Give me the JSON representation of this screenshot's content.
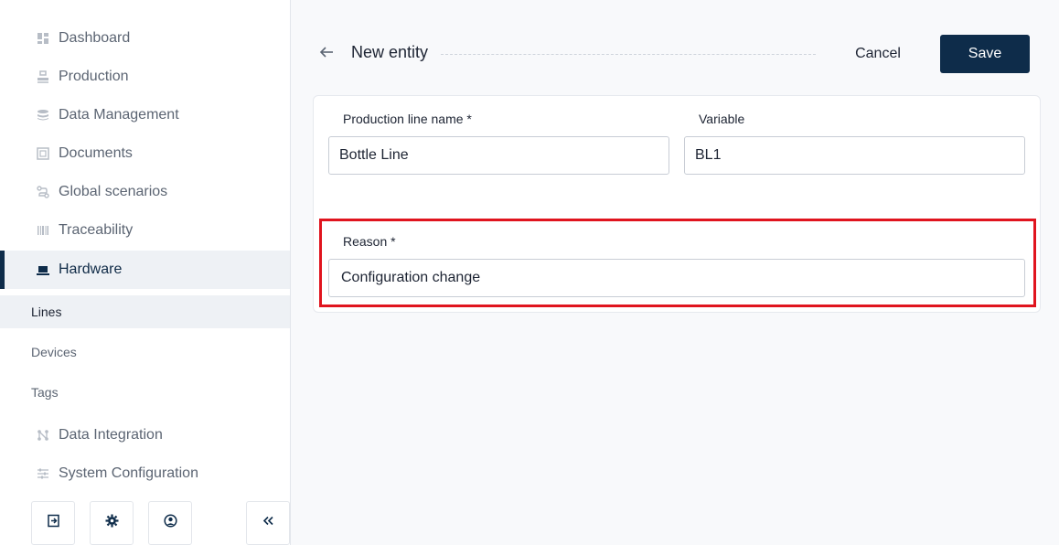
{
  "sidebar": {
    "items": [
      {
        "label": "Dashboard",
        "icon": "dashboard-icon"
      },
      {
        "label": "Production",
        "icon": "production-icon"
      },
      {
        "label": "Data Management",
        "icon": "database-icon"
      },
      {
        "label": "Documents",
        "icon": "documents-icon"
      },
      {
        "label": "Global scenarios",
        "icon": "scenarios-icon"
      },
      {
        "label": "Traceability",
        "icon": "barcode-icon"
      },
      {
        "label": "Hardware",
        "icon": "hardware-icon",
        "active": true
      }
    ],
    "sub_items": [
      {
        "label": "Lines",
        "active": true
      },
      {
        "label": "Devices"
      },
      {
        "label": "Tags"
      }
    ],
    "items_after": [
      {
        "label": "Data Integration",
        "icon": "integration-icon"
      },
      {
        "label": "System Configuration",
        "icon": "sliders-icon"
      }
    ],
    "footer_buttons": [
      "logout-icon",
      "settings-icon",
      "user-icon",
      "collapse-icon"
    ]
  },
  "header": {
    "title": "New entity",
    "cancel_label": "Cancel",
    "save_label": "Save"
  },
  "form": {
    "name_label": "Production line name *",
    "name_value": "Bottle Line",
    "variable_label": "Variable",
    "variable_value": "BL1",
    "reason_label": "Reason *",
    "reason_value": "Configuration change"
  },
  "colors": {
    "primary": "#0e2c4a",
    "highlight": "#e0141e",
    "active_bg": "#eef1f5"
  }
}
